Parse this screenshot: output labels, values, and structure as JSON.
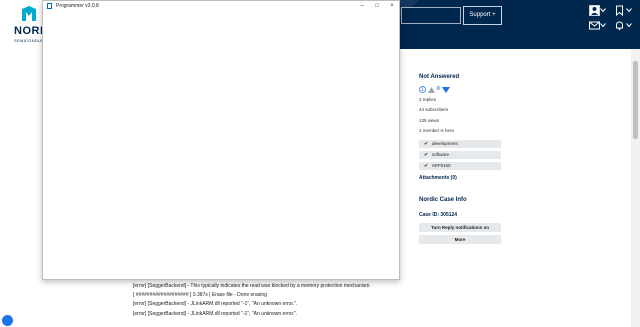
{
  "header": {
    "logo_text": "NORDI",
    "logo_sub": "SEMICONDUCT",
    "support_label": "Support +"
  },
  "sidebar": {
    "status_heading": "Not Answered",
    "vote_count": "0",
    "replies": "2 replies",
    "subscribers": "44 subscribers",
    "views": "135 views",
    "members_here": "1 member is here",
    "tags": [
      "development",
      "software",
      "nRF9160"
    ],
    "attachments": "Attachments (0)",
    "case_heading": "Nordic Case Info",
    "case_id": "Case ID: 305124",
    "reply_notifications_label": "Turn Reply notifications on",
    "more_label": "More"
  },
  "log": {
    "lines": [
      "[error] [SeggerBackend] - This typically indicates the read was blocked by a memory protection mechanism.",
      "[ ################### ] 0.387s | Erase file - Done erasing",
      "[error] [SeggerBackend] - JLinkARM.dll reported \"-1\", \"An unknown error.\".",
      "[error] [SeggerBackend] - JLinkARM.dll reported \"-1\", \"An unknown error.\"."
    ]
  },
  "window": {
    "title": "Programmer v3.0.8",
    "minimize_label": "–",
    "maximize_label": "□",
    "close_label": "×"
  },
  "colors": {
    "header_bg": "#00274d",
    "accent": "#1a73e8"
  }
}
